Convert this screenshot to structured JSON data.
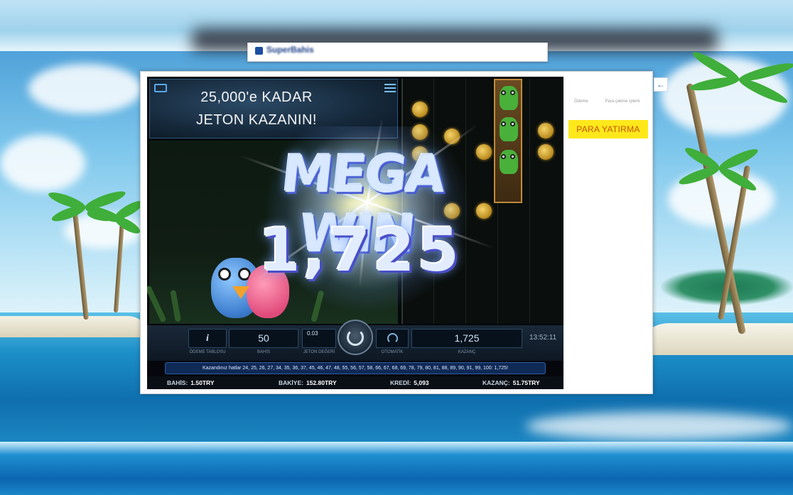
{
  "browser": {
    "tab_title": "SuperBahis"
  },
  "side_panel": {
    "links": [
      "Ödeme",
      "Para çekme işlemi"
    ],
    "deposit_button": "PARA YATIRMA",
    "back_button": "←"
  },
  "game": {
    "promo": {
      "line1": "25,000'e KADAR",
      "line2": "JETON KAZANIN!"
    },
    "big_win": {
      "title": "MEGA WIN",
      "amount": "1,725"
    },
    "controls": {
      "info_label": "i",
      "info_caption": "ÖDEME TABLOSU",
      "bet_value": "50",
      "bet_caption": "BAHİS",
      "coin_value": "0.03",
      "coin_caption": "JETON DEĞERİ",
      "autoplay_caption": "OTOMATİK",
      "win_value": "1,725",
      "win_caption": "KAZANÇ",
      "clock": "13:52:11"
    },
    "winlines_text": "Kazandınız hatlar 24, 25, 26, 27, 34, 35, 36, 37, 45, 46, 47, 48, 55, 56, 57, 58, 66, 67, 68, 69, 78, 79, 80, 81, 88, 89, 90, 91, 99, 100: 1,725!",
    "status": {
      "bet_label": "BAHİS:",
      "bet_value": "1.50TRY",
      "balance_label": "BAKİYE:",
      "balance_value": "152.80TRY",
      "credit_label": "KREDİ:",
      "credit_value": "5,093",
      "win_label": "KAZANÇ:",
      "win_value": "51.75TRY"
    }
  },
  "colors": {
    "deposit_button_bg": "#ffe81a",
    "deposit_button_text": "#c8500a",
    "win_text": "#d8e8ff",
    "winlines_bg": "#0f2a55"
  },
  "icons": [
    "fullscreen-icon",
    "menu-icon",
    "spin-icon",
    "autoplay-icon",
    "info-icon",
    "back-arrow-icon"
  ]
}
